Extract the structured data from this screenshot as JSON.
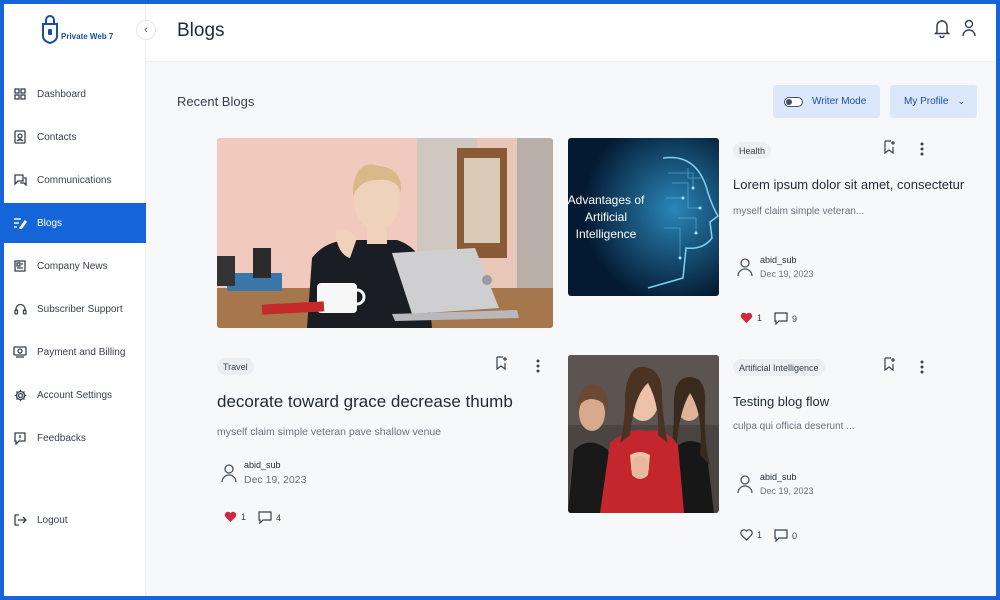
{
  "app": {
    "logo_text": "Private Web 7"
  },
  "sidebar": {
    "items": [
      {
        "label": "Dashboard",
        "icon": "grid-icon",
        "active": false
      },
      {
        "label": "Contacts",
        "icon": "contact-card-icon",
        "active": false
      },
      {
        "label": "Communications",
        "icon": "chat-icon",
        "active": false
      },
      {
        "label": "Blogs",
        "icon": "edit-list-icon",
        "active": true
      },
      {
        "label": "Company News",
        "icon": "newspaper-icon",
        "active": false
      },
      {
        "label": "Subscriber Support",
        "icon": "headset-icon",
        "active": false
      },
      {
        "label": "Payment and Billing",
        "icon": "payment-icon",
        "active": false
      },
      {
        "label": "Account Settings",
        "icon": "gear-icon",
        "active": false
      },
      {
        "label": "Feedbacks",
        "icon": "feedback-icon",
        "active": false
      }
    ],
    "logout_label": "Logout"
  },
  "header": {
    "title": "Blogs"
  },
  "main": {
    "section_title": "Recent Blogs",
    "writer_mode_label": "Writer Mode",
    "my_profile_label": "My Profile"
  },
  "posts": [
    {
      "image_text": [
        "Advantages of",
        "Artificial",
        "Intelligence"
      ],
      "tag": "Health",
      "title": "Lorem ipsum dolor sit amet, consectetur",
      "description": "myself claim simple veteran...",
      "author": "abid_sub",
      "date": "Dec 19, 2023",
      "likes": "1",
      "comments": "9",
      "liked": true
    },
    {
      "tag": "Travel",
      "title": "decorate toward grace decrease thumb",
      "description": "myself claim simple veteran pave shallow venue",
      "author": "abid_sub",
      "date": "Dec 19, 2023",
      "likes": "1",
      "comments": "4",
      "liked": true
    },
    {
      "tag": "Artificial Intelligence",
      "title": "Testing blog flow",
      "description": "culpa qui officia deserunt ...",
      "author": "abid_sub",
      "date": "Dec 19, 2023",
      "likes": "1",
      "comments": "0",
      "liked": false
    }
  ],
  "colors": {
    "accent": "#1565d8",
    "like": "#d1283a",
    "tag_bg": "#eceef1",
    "button_bg": "#dbe8fb"
  }
}
